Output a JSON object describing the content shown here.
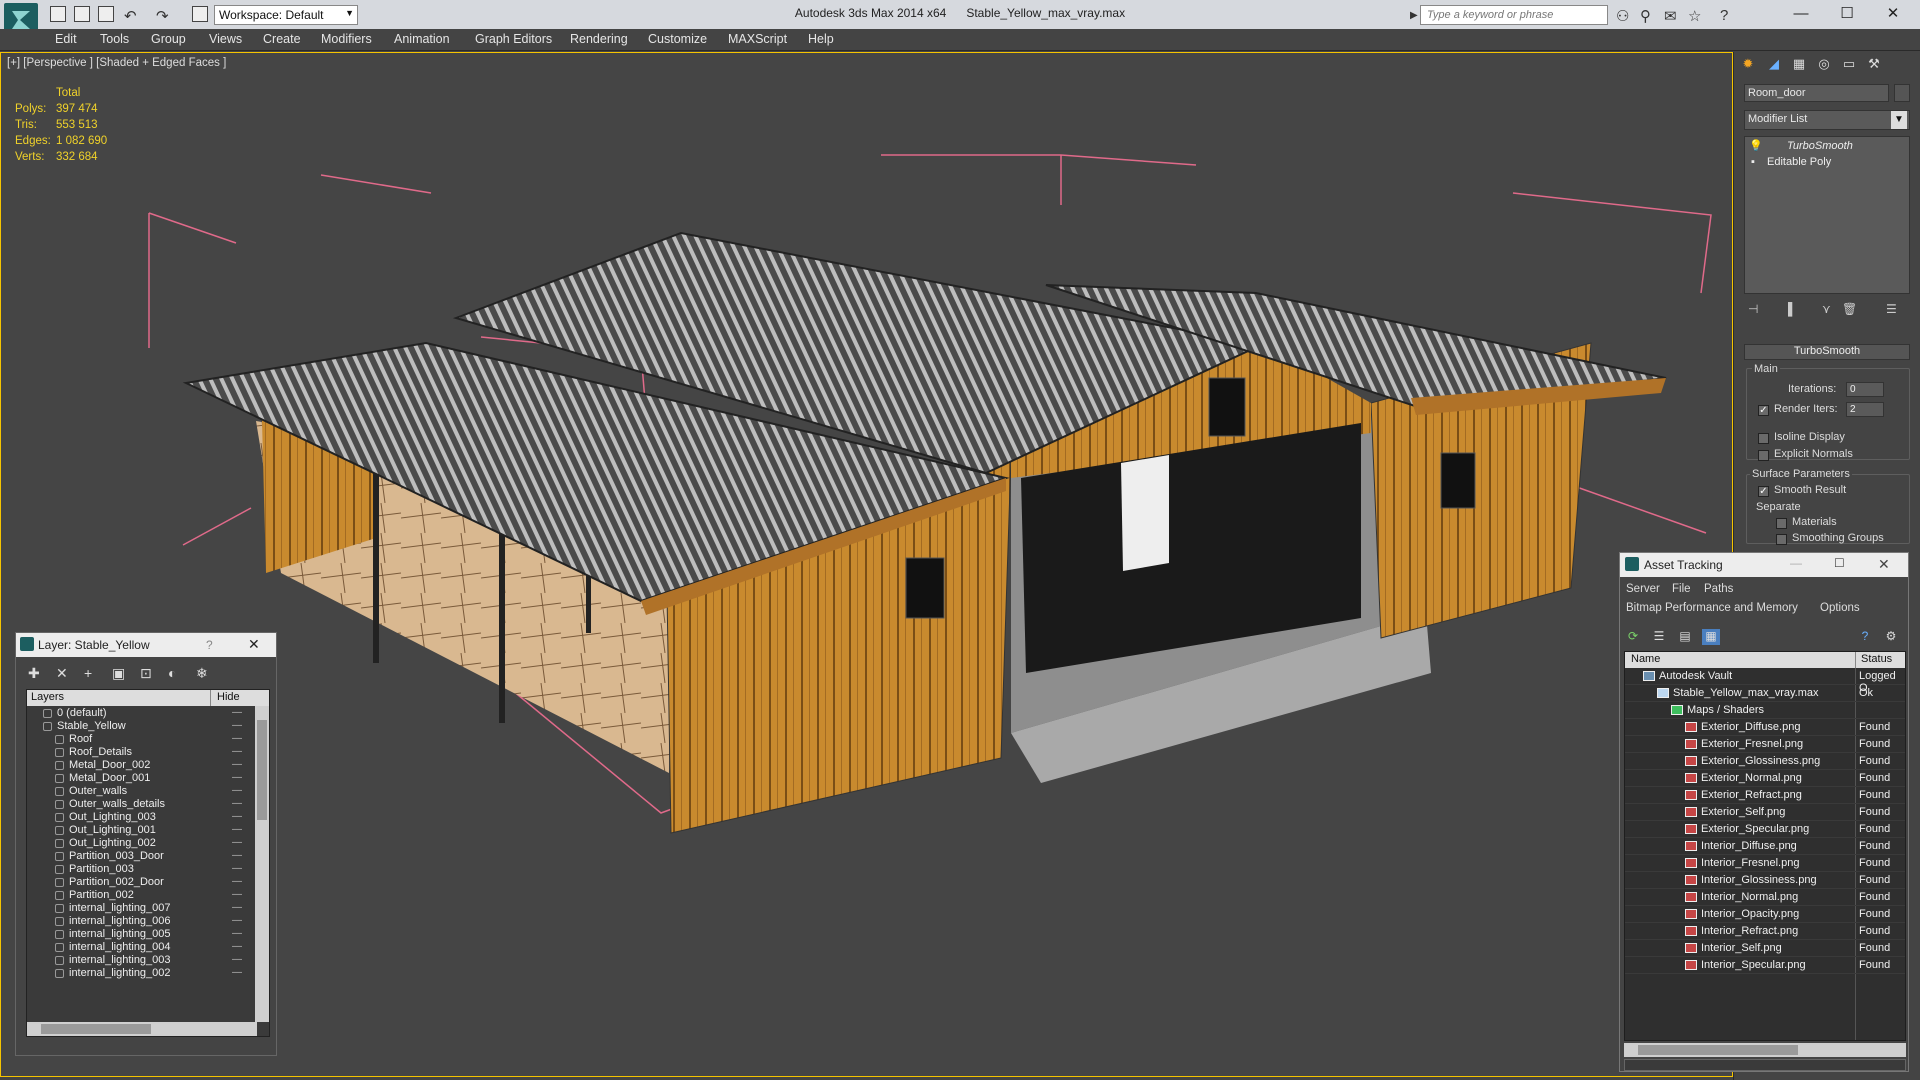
{
  "titlebar": {
    "app_title": "Autodesk 3ds Max  2014 x64",
    "file_name": "Stable_Yellow_max_vray.max",
    "workspace": "Workspace: Default",
    "search_placeholder": "Type a keyword or phrase"
  },
  "menu": [
    "Edit",
    "Tools",
    "Group",
    "Views",
    "Create",
    "Modifiers",
    "Animation",
    "Graph Editors",
    "Rendering",
    "Customize",
    "MAXScript",
    "Help"
  ],
  "viewport": {
    "label": "[+] [Perspective ] [Shaded + Edged Faces ]",
    "stats": {
      "header": "Total",
      "rows": [
        {
          "k": "Polys:",
          "v": "397 474"
        },
        {
          "k": "Tris:",
          "v": "553 513"
        },
        {
          "k": "Edges:",
          "v": "1 082 690"
        },
        {
          "k": "Verts:",
          "v": "332 684"
        }
      ]
    }
  },
  "command_panel": {
    "object_name": "Room_door",
    "modifier_list": "Modifier List",
    "stack": [
      "TurboSmooth",
      "Editable Poly"
    ],
    "rollout": "TurboSmooth",
    "main_label": "Main",
    "iterations_label": "Iterations:",
    "iterations_value": "0",
    "render_iters_label": "Render Iters:",
    "render_iters_value": "2",
    "isoline": "Isoline Display",
    "explicit": "Explicit Normals",
    "surface": "Surface Parameters",
    "smooth_result": "Smooth Result",
    "separate": "Separate",
    "materials": "Materials",
    "smoothing": "Smoothing Groups"
  },
  "layers": {
    "title": "Layer: Stable_Yellow",
    "help": "?",
    "col_layers": "Layers",
    "col_hide": "Hide",
    "rows": [
      {
        "name": "0 (default)",
        "level": 0
      },
      {
        "name": "Stable_Yellow",
        "level": 0
      },
      {
        "name": "Roof",
        "level": 1
      },
      {
        "name": "Roof_Details",
        "level": 1
      },
      {
        "name": "Metal_Door_002",
        "level": 1
      },
      {
        "name": "Metal_Door_001",
        "level": 1
      },
      {
        "name": "Outer_walls",
        "level": 1
      },
      {
        "name": "Outer_walls_details",
        "level": 1
      },
      {
        "name": "Out_Lighting_003",
        "level": 1
      },
      {
        "name": "Out_Lighting_001",
        "level": 1
      },
      {
        "name": "Out_Lighting_002",
        "level": 1
      },
      {
        "name": "Partition_003_Door",
        "level": 1
      },
      {
        "name": "Partition_003",
        "level": 1
      },
      {
        "name": "Partition_002_Door",
        "level": 1
      },
      {
        "name": "Partition_002",
        "level": 1
      },
      {
        "name": "internal_lighting_007",
        "level": 1
      },
      {
        "name": "internal_lighting_006",
        "level": 1
      },
      {
        "name": "internal_lighting_005",
        "level": 1
      },
      {
        "name": "internal_lighting_004",
        "level": 1
      },
      {
        "name": "internal_lighting_003",
        "level": 1
      },
      {
        "name": "internal_lighting_002",
        "level": 1
      }
    ]
  },
  "asset_tracking": {
    "title": "Asset Tracking",
    "menu": [
      "Server",
      "File",
      "Paths"
    ],
    "menu2": [
      "Bitmap Performance and Memory",
      "Options"
    ],
    "col_name": "Name",
    "col_status": "Status",
    "rows": [
      {
        "name": "Autodesk Vault",
        "status": "Logged O",
        "level": 0
      },
      {
        "name": "Stable_Yellow_max_vray.max",
        "status": "Ok",
        "level": 1
      },
      {
        "name": "Maps / Shaders",
        "status": "",
        "level": 2
      },
      {
        "name": "Exterior_Diffuse.png",
        "status": "Found",
        "level": 3
      },
      {
        "name": "Exterior_Fresnel.png",
        "status": "Found",
        "level": 3
      },
      {
        "name": "Exterior_Glossiness.png",
        "status": "Found",
        "level": 3
      },
      {
        "name": "Exterior_Normal.png",
        "status": "Found",
        "level": 3
      },
      {
        "name": "Exterior_Refract.png",
        "status": "Found",
        "level": 3
      },
      {
        "name": "Exterior_Self.png",
        "status": "Found",
        "level": 3
      },
      {
        "name": "Exterior_Specular.png",
        "status": "Found",
        "level": 3
      },
      {
        "name": "Interior_Diffuse.png",
        "status": "Found",
        "level": 3
      },
      {
        "name": "Interior_Fresnel.png",
        "status": "Found",
        "level": 3
      },
      {
        "name": "Interior_Glossiness.png",
        "status": "Found",
        "level": 3
      },
      {
        "name": "Interior_Normal.png",
        "status": "Found",
        "level": 3
      },
      {
        "name": "Interior_Opacity.png",
        "status": "Found",
        "level": 3
      },
      {
        "name": "Interior_Refract.png",
        "status": "Found",
        "level": 3
      },
      {
        "name": "Interior_Self.png",
        "status": "Found",
        "level": 3
      },
      {
        "name": "Interior_Specular.png",
        "status": "Found",
        "level": 3
      }
    ]
  }
}
